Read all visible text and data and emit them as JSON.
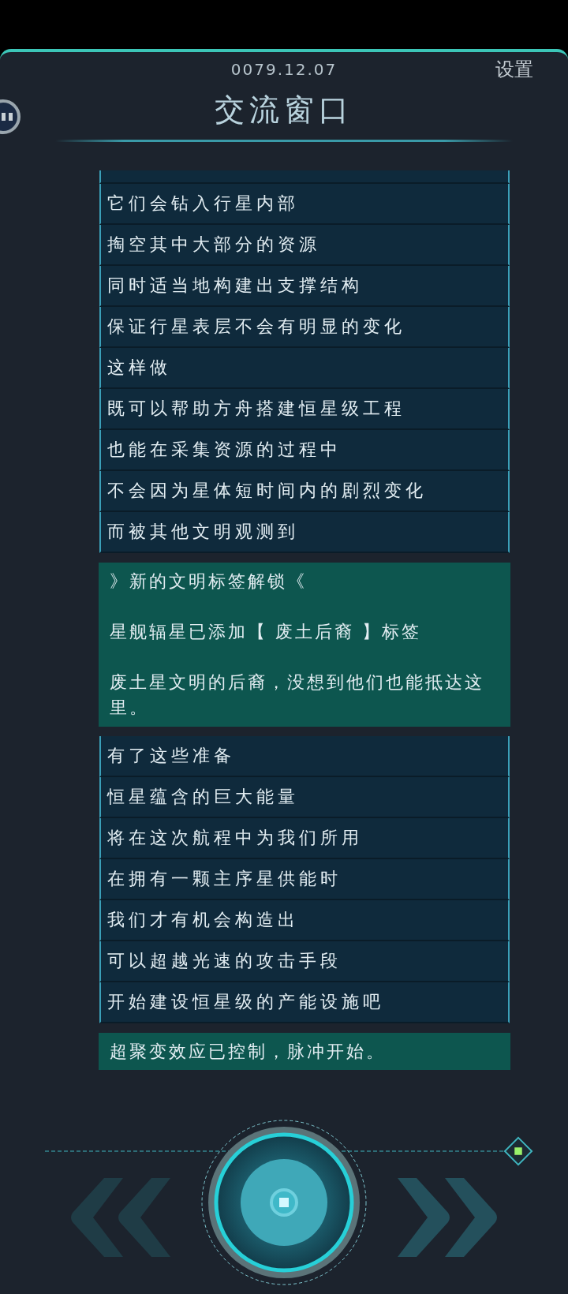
{
  "header": {
    "date": "0079.12.07",
    "settings": "设置",
    "title": "交流窗口"
  },
  "messages": [
    {
      "kind": "clipped"
    },
    {
      "kind": "line",
      "text": "它们会钻入行星内部"
    },
    {
      "kind": "line",
      "text": "掏空其中大部分的资源"
    },
    {
      "kind": "line",
      "text": "同时适当地构建出支撑结构"
    },
    {
      "kind": "line",
      "text": "保证行星表层不会有明显的变化"
    },
    {
      "kind": "line",
      "text": "这样做"
    },
    {
      "kind": "line",
      "text": "既可以帮助方舟搭建恒星级工程"
    },
    {
      "kind": "line",
      "text": "也能在采集资源的过程中"
    },
    {
      "kind": "line",
      "text": "不会因为星体短时间内的剧烈变化"
    },
    {
      "kind": "line",
      "text": "而被其他文明观测到"
    },
    {
      "kind": "notice",
      "paragraphs": [
        "》新的文明标签解锁《",
        "星舰辐星已添加【 废土后裔 】标签",
        "废土星文明的后裔，没想到他们也能抵达这里。"
      ]
    },
    {
      "kind": "line",
      "text": "有了这些准备"
    },
    {
      "kind": "line",
      "text": "恒星蕴含的巨大能量"
    },
    {
      "kind": "line",
      "text": "将在这次航程中为我们所用"
    },
    {
      "kind": "line",
      "text": "在拥有一颗主序星供能时"
    },
    {
      "kind": "line",
      "text": "我们才有机会构造出"
    },
    {
      "kind": "line",
      "text": "可以超越光速的攻击手段"
    },
    {
      "kind": "line",
      "text": "开始建设恒星级的产能设施吧"
    },
    {
      "kind": "notice",
      "paragraphs": [
        "超聚变效应已控制，脉冲开始。"
      ]
    }
  ]
}
